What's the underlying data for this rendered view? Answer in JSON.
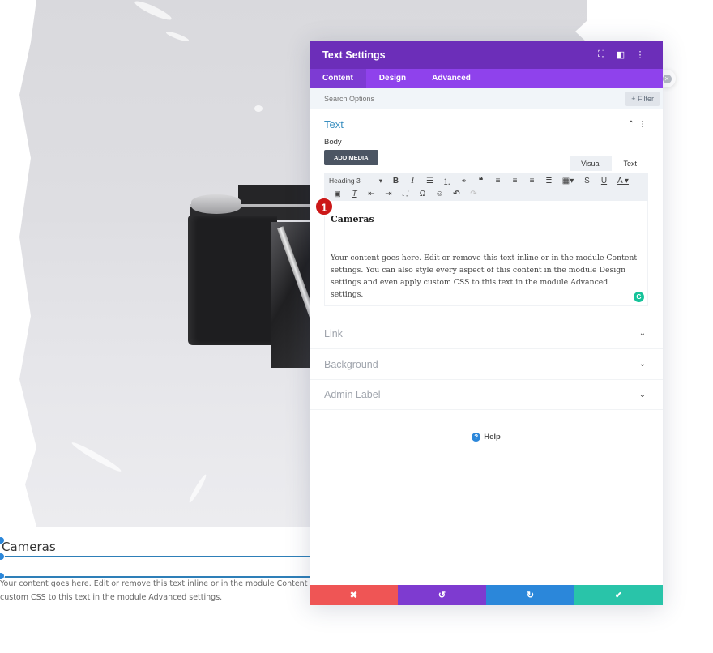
{
  "panel": {
    "title": "Text Settings",
    "header_icons": [
      "fullscreen-icon",
      "split-view-icon",
      "more-options-icon"
    ],
    "header_icon_glyphs": [
      "⛶",
      "◧",
      "⋮"
    ],
    "tabs": [
      {
        "label": "Content",
        "active": true
      },
      {
        "label": "Design",
        "active": false
      },
      {
        "label": "Advanced",
        "active": false
      }
    ],
    "search": {
      "placeholder": "Search Options",
      "value": ""
    },
    "filter_label": "+ Filter",
    "text_section": {
      "title": "Text",
      "body_label": "Body",
      "add_media_label": "ADD MEDIA",
      "mode_tabs": [
        {
          "label": "Visual",
          "active": true
        },
        {
          "label": "Text",
          "active": false
        }
      ],
      "toolbar": {
        "format_select": "Heading 3",
        "row1_icons": [
          "bold-icon",
          "italic-icon",
          "bullet-list-icon",
          "numbered-list-icon",
          "link-icon",
          "blockquote-icon",
          "align-left-icon",
          "align-center-icon",
          "align-right-icon",
          "align-justify-icon",
          "table-icon",
          "strikethrough-icon",
          "underline-icon",
          "text-color-icon"
        ],
        "row1_glyphs": [
          "B",
          "I",
          "☰",
          "⒈",
          "🔗",
          "❝",
          "≡",
          "≡",
          "≡",
          "≣",
          "▦▾",
          "S",
          "U",
          "A ▾"
        ],
        "row2_icons": [
          "paste-icon",
          "clear-formatting-icon",
          "outdent-icon",
          "indent-icon",
          "fullscreen-icon",
          "special-character-icon",
          "emoji-icon",
          "undo-icon",
          "redo-icon"
        ],
        "row2_glyphs": [
          "📋",
          "T̲ₓ",
          "⇤",
          "⇥",
          "⛶",
          "Ω",
          "☺",
          "↶",
          "↷"
        ]
      },
      "editor": {
        "heading": "Cameras",
        "paragraph": "Your content goes here. Edit or remove this text inline or in the module Content settings. You can also style every aspect of this content in the module Design settings and even apply custom CSS to this text in the module Advanced settings."
      },
      "step_badge": "1"
    },
    "collapsed_sections": [
      {
        "label": "Link"
      },
      {
        "label": "Background"
      },
      {
        "label": "Admin Label"
      }
    ],
    "help_label": "Help",
    "footer": [
      {
        "name": "discard",
        "glyph": "✖",
        "color": "#ef5555"
      },
      {
        "name": "undo",
        "glyph": "↺",
        "color": "#7e3bd0"
      },
      {
        "name": "redo",
        "glyph": "↻",
        "color": "#2b87da"
      },
      {
        "name": "save",
        "glyph": "✔",
        "color": "#29c4a9"
      }
    ]
  },
  "page_module": {
    "title": "Cameras",
    "text_line1": "Your content goes here. Edit or remove this text inline or in the module Content settings. You",
    "text_line2": "custom CSS to this text in the module Advanced settings."
  },
  "colors": {
    "header_purple": "#6c2eb9",
    "tab_purple": "#8f42ec",
    "section_blue": "#3a8fc0",
    "badge_red": "#cc1818"
  }
}
